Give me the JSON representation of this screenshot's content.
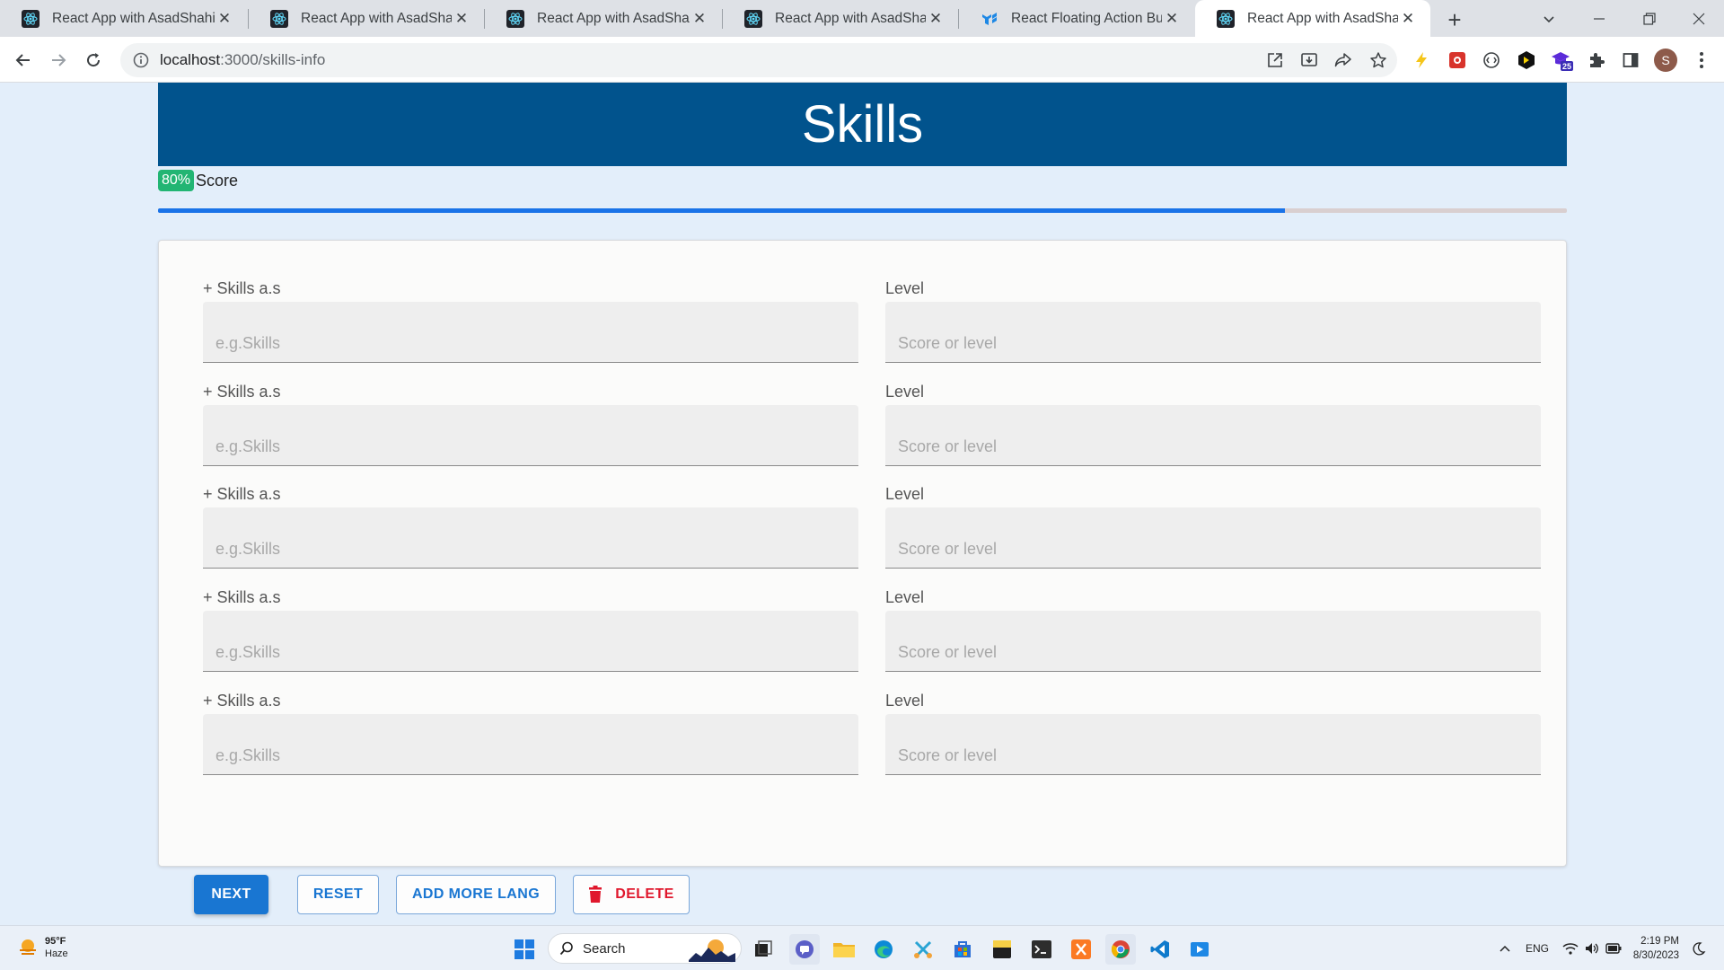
{
  "browser": {
    "tabs": [
      {
        "title": "React App with AsadShahi",
        "favicon": "react-icon",
        "active": false
      },
      {
        "title": "React App with AsadShahi",
        "favicon": "react-icon",
        "active": false
      },
      {
        "title": "React App with AsadShahi",
        "favicon": "react-icon",
        "active": false
      },
      {
        "title": "React App with AsadShahi",
        "favicon": "react-icon",
        "active": false
      },
      {
        "title": "React Floating Action Button",
        "favicon": "mui-icon",
        "active": false
      },
      {
        "title": "React App with AsadShahi",
        "favicon": "react-icon",
        "active": true
      }
    ],
    "url_host": "localhost",
    "url_path": ":3000/skills-info",
    "profile_initial": "S",
    "extension_badge": "25"
  },
  "page": {
    "title": "Skills",
    "score_badge": "80%",
    "score_label": "Score",
    "progress": 0.8,
    "skill_label": "+ Skills a.s",
    "level_label": "Level",
    "skill_placeholder": "e.g.Skills",
    "level_placeholder": "Score or level",
    "rows": [
      {
        "skill_label": "+ Skills a.s",
        "skill_value": "",
        "level_label": "Level",
        "level_value": ""
      },
      {
        "skill_label": "+ Skills a.s",
        "skill_value": "",
        "level_label": "Level",
        "level_value": ""
      },
      {
        "skill_label": "+ Skills a.s",
        "skill_value": "",
        "level_label": "Level",
        "level_value": ""
      },
      {
        "skill_label": "+ Skills a.s",
        "skill_value": "",
        "level_label": "Level",
        "level_value": ""
      },
      {
        "skill_label": "+ Skills a.s",
        "skill_value": "",
        "level_label": "Level",
        "level_value": ""
      }
    ],
    "buttons": {
      "next": "NEXT",
      "reset": "RESET",
      "add_more": "ADD MORE LANG",
      "delete": "DELETE"
    },
    "colors": {
      "header": "#01538d",
      "badge": "#22b573",
      "primary": "#1976d2",
      "danger": "#e0182d",
      "progress": "#1a73e8"
    }
  },
  "taskbar": {
    "weather_temp": "95°F",
    "weather_desc": "Haze",
    "search_label": "Search",
    "language": "ENG",
    "time": "2:19 PM",
    "date": "8/30/2023"
  }
}
